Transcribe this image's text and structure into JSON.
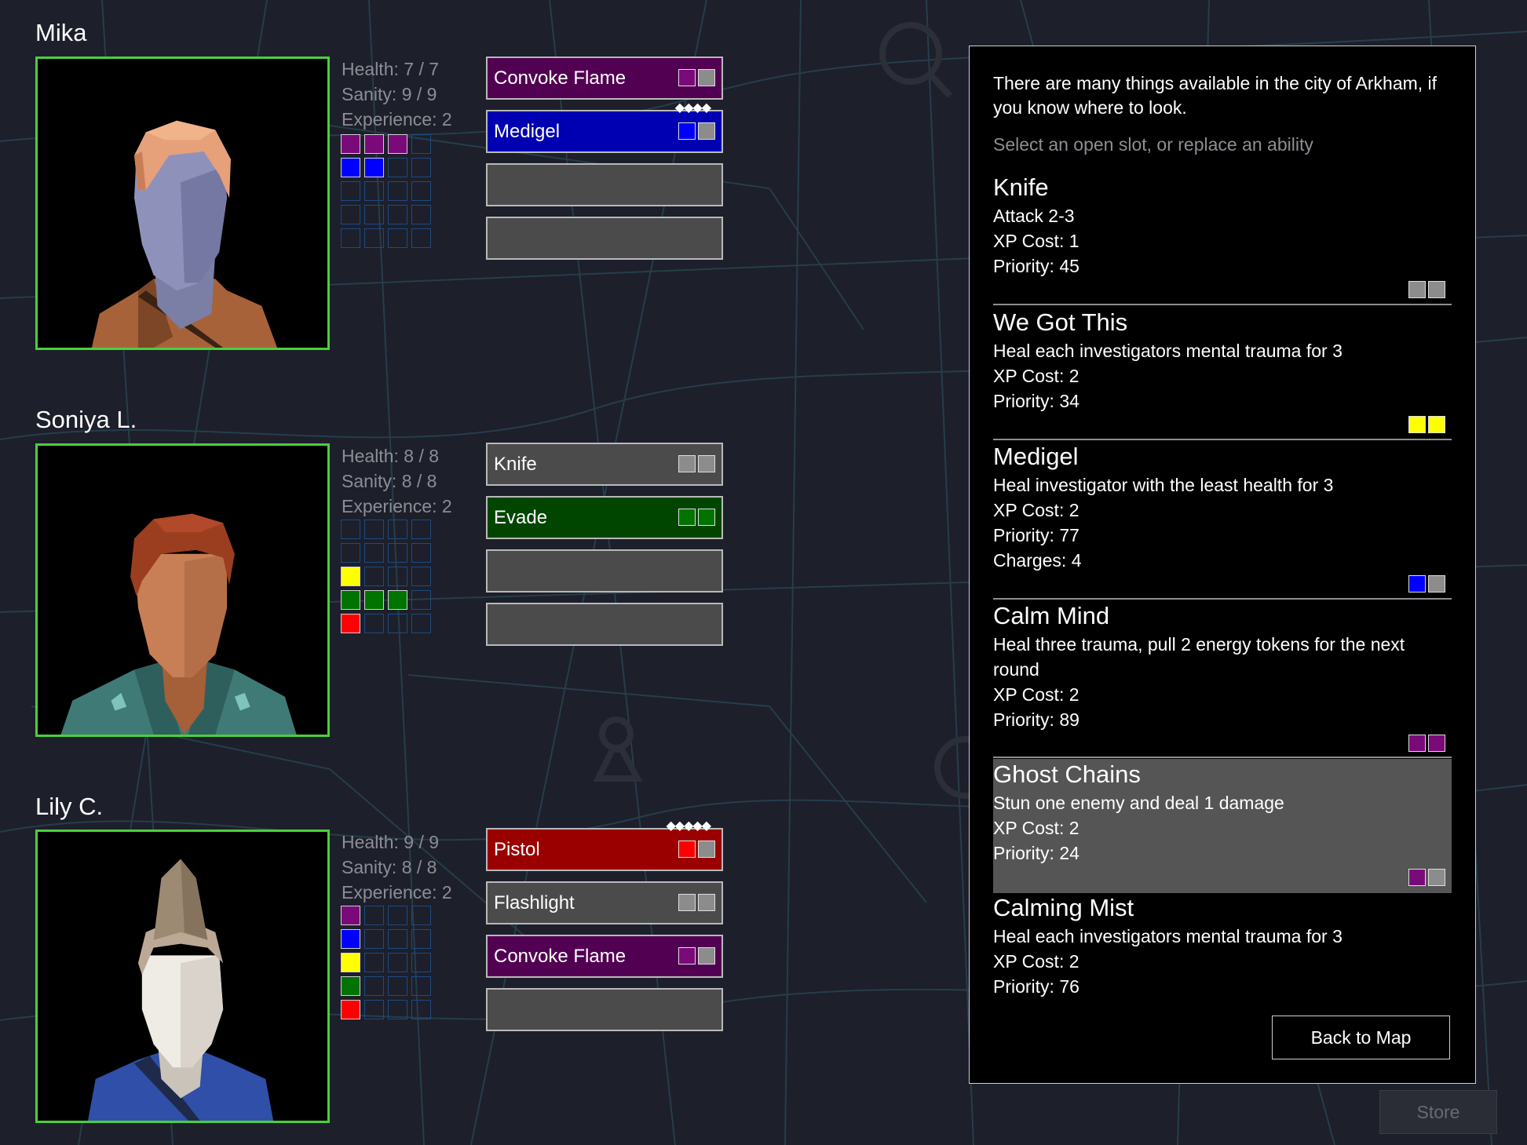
{
  "colors": {
    "purple": "#7a0a7a",
    "blue": "#0000ff",
    "green": "#007300",
    "red": "#ff0000",
    "yellow": "#ffff00",
    "gray": "#8c8c8c",
    "portrait_border": "#4ccf3c"
  },
  "investigators": [
    {
      "name": "Mika",
      "health": "Health: 7 / 7",
      "sanity": "Sanity: 9 / 9",
      "experience": "Experience: 2",
      "energy_rows": [
        [
          "purple",
          "purple",
          "purple",
          "empty"
        ],
        [
          "blue",
          "blue",
          "empty",
          "empty"
        ],
        [
          "empty",
          "empty",
          "empty",
          "empty"
        ],
        [
          "empty",
          "empty",
          "empty",
          "empty"
        ],
        [
          "empty",
          "empty",
          "empty",
          "empty"
        ]
      ],
      "abilities": [
        {
          "label": "Convoke Flame",
          "style": "purple",
          "chips": [
            "purple",
            "gray"
          ],
          "charges": ""
        },
        {
          "label": "Medigel",
          "style": "blue",
          "chips": [
            "blue",
            "gray"
          ],
          "charges": "◆◆◆◆"
        },
        {
          "label": "",
          "style": "empty",
          "chips": [],
          "charges": ""
        },
        {
          "label": "",
          "style": "empty",
          "chips": [],
          "charges": ""
        }
      ]
    },
    {
      "name": "Soniya L.",
      "health": "Health: 8 / 8",
      "sanity": "Sanity: 8 / 8",
      "experience": "Experience: 2",
      "energy_rows": [
        [
          "empty",
          "empty",
          "empty",
          "empty"
        ],
        [
          "empty",
          "empty",
          "empty",
          "empty"
        ],
        [
          "yellow",
          "empty",
          "empty",
          "empty"
        ],
        [
          "green",
          "green",
          "green",
          "empty"
        ],
        [
          "red",
          "empty",
          "empty",
          "empty"
        ]
      ],
      "abilities": [
        {
          "label": "Knife",
          "style": "gray",
          "chips": [
            "gray",
            "gray"
          ],
          "charges": ""
        },
        {
          "label": "Evade",
          "style": "green",
          "chips": [
            "green",
            "green"
          ],
          "charges": ""
        },
        {
          "label": "",
          "style": "empty",
          "chips": [],
          "charges": ""
        },
        {
          "label": "",
          "style": "empty",
          "chips": [],
          "charges": ""
        }
      ]
    },
    {
      "name": "Lily C.",
      "health": "Health: 9 / 9",
      "sanity": "Sanity: 8 / 8",
      "experience": "Experience: 2",
      "energy_rows": [
        [
          "purple",
          "empty",
          "empty",
          "empty"
        ],
        [
          "blue",
          "empty",
          "empty",
          "empty"
        ],
        [
          "yellow",
          "empty",
          "empty",
          "empty"
        ],
        [
          "green",
          "empty",
          "empty",
          "empty"
        ],
        [
          "red",
          "empty",
          "empty",
          "empty"
        ]
      ],
      "abilities": [
        {
          "label": "Pistol",
          "style": "red",
          "chips": [
            "red",
            "gray"
          ],
          "charges": "◆◆◆◆◆"
        },
        {
          "label": "Flashlight",
          "style": "gray",
          "chips": [
            "gray",
            "gray"
          ],
          "charges": ""
        },
        {
          "label": "Convoke Flame",
          "style": "purple",
          "chips": [
            "purple",
            "gray"
          ],
          "charges": ""
        },
        {
          "label": "",
          "style": "empty",
          "chips": [],
          "charges": ""
        }
      ]
    }
  ],
  "store": {
    "intro": "There are many things available in the city of Arkham, if you know where to look.",
    "hint": "Select an open slot, or replace an ability",
    "offers": [
      {
        "title": "Knife",
        "lines": [
          "Attack 2-3",
          "XP Cost: 1",
          "Priority: 45"
        ],
        "chips": [
          "gray",
          "gray"
        ],
        "selected": false
      },
      {
        "title": "We Got This",
        "lines": [
          "Heal each investigators mental trauma for 3",
          "XP Cost: 2",
          "Priority: 34"
        ],
        "chips": [
          "yellow",
          "yellow"
        ],
        "selected": false
      },
      {
        "title": "Medigel",
        "lines": [
          "Heal investigator with the least health for 3",
          "XP Cost: 2",
          "Priority: 77",
          "Charges: 4"
        ],
        "chips": [
          "blue",
          "gray"
        ],
        "selected": false
      },
      {
        "title": "Calm Mind",
        "lines": [
          "Heal three trauma, pull 2 energy tokens for the next",
          "round",
          "XP Cost: 2",
          "Priority: 89"
        ],
        "chips": [
          "purple",
          "purple"
        ],
        "selected": false
      },
      {
        "title": "Ghost Chains",
        "lines": [
          "Stun one enemy and deal 1 damage",
          "XP Cost: 2",
          "Priority: 24"
        ],
        "chips": [
          "purple",
          "gray"
        ],
        "selected": true
      },
      {
        "title": "Calming Mist",
        "lines": [
          "Heal each investigators mental trauma for 3",
          "XP Cost: 2",
          "Priority: 76"
        ],
        "chips": [],
        "selected": false
      }
    ],
    "back_label": "Back to Map"
  },
  "store_button_label": "Store"
}
